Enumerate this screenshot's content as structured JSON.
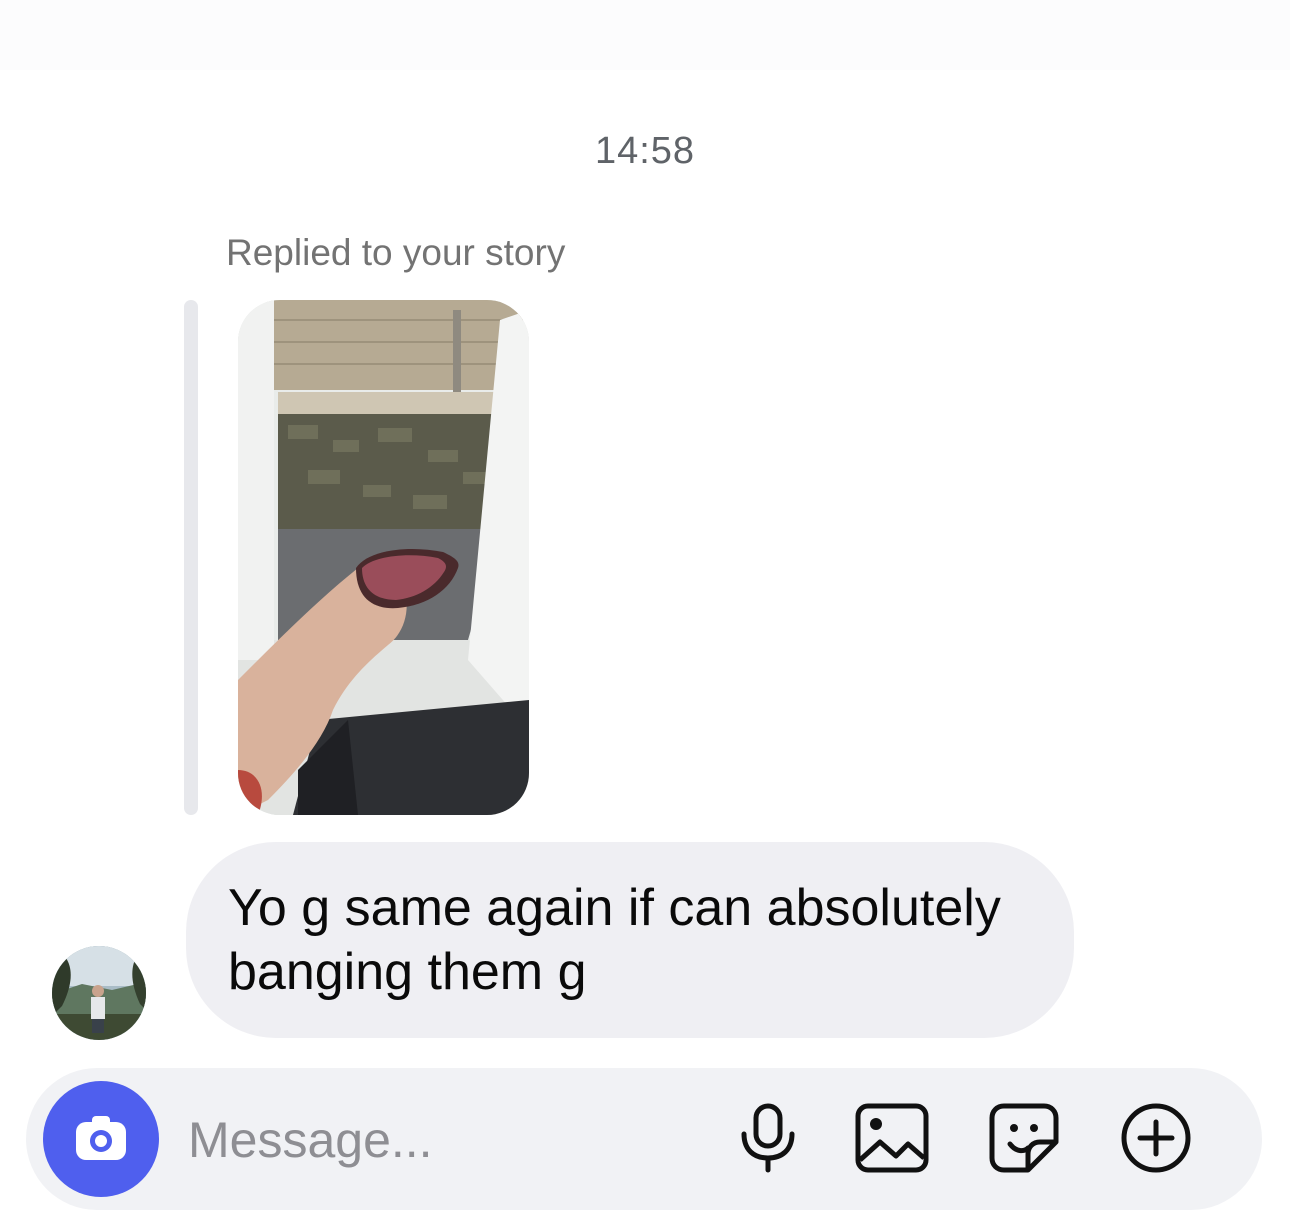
{
  "thread": {
    "timestamp": "14:58",
    "reply_label": "Replied to your story",
    "message": {
      "line1": "Yo g same again if can absolutely",
      "line2": "banging them g"
    }
  },
  "composer": {
    "placeholder": "Message...",
    "icons": [
      "camera-icon",
      "microphone-icon",
      "image-icon",
      "sticker-icon",
      "plus-icon"
    ]
  },
  "colors": {
    "accent": "#4f5fee",
    "bubble": "#efeff3",
    "composer_bg": "#f1f2f5",
    "secondary_text": "#737373"
  }
}
